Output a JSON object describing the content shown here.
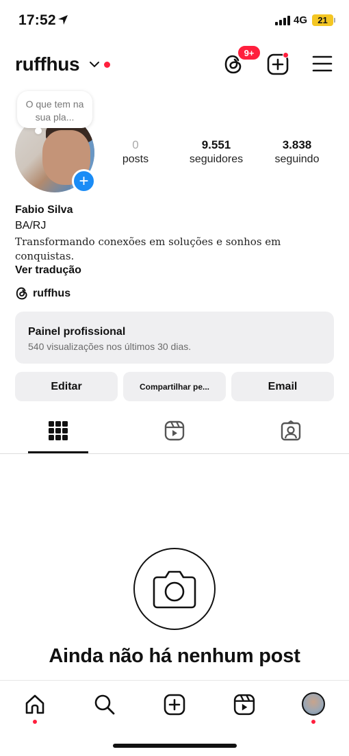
{
  "status_bar": {
    "time": "17:52",
    "network": "4G",
    "battery": "21"
  },
  "header": {
    "username": "ruffhus",
    "notification_badge": "9+"
  },
  "profile": {
    "note": "O que tem na sua pla...",
    "stats": {
      "posts": {
        "value": "0",
        "label": "posts"
      },
      "followers": {
        "value": "9.551",
        "label": "seguidores"
      },
      "following": {
        "value": "3.838",
        "label": "seguindo"
      }
    },
    "name": "Fabio Silva",
    "location": "BA/RJ",
    "bio": "Transformando conexões em soluções e sonhos em conquistas.",
    "translate_label": "Ver tradução",
    "threads_handle": "ruffhus"
  },
  "dashboard": {
    "title": "Painel profissional",
    "subtitle": "540 visualizações nos últimos 30 dias."
  },
  "actions": {
    "edit": "Editar",
    "share": "Compartilhar pe...",
    "email": "Email"
  },
  "empty_state": {
    "title": "Ainda não há nenhum post"
  },
  "colors": {
    "accent_blue": "#1a8cf6",
    "notification_red": "#ff1f3d",
    "button_gray": "#efeff1"
  }
}
